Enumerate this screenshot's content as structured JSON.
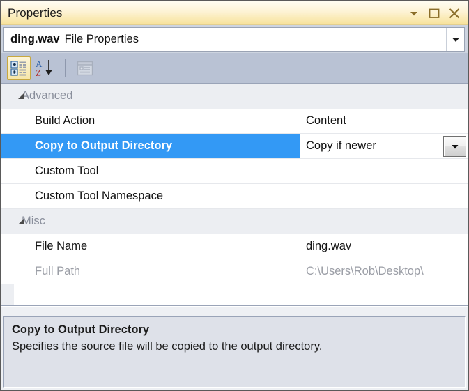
{
  "window": {
    "title": "Properties",
    "buttons": [
      {
        "name": "dropdown",
        "label": "Window options"
      },
      {
        "name": "maximize",
        "label": "Maximize"
      },
      {
        "name": "close",
        "label": "Close"
      }
    ]
  },
  "selector": {
    "object_name": "ding.wav",
    "object_type": "File Properties",
    "arrow": "chevron-down-icon"
  },
  "toolbar": {
    "categorized": {
      "label": "Categorized",
      "active": true
    },
    "alphabetical": {
      "label": "Alphabetical",
      "active": false,
      "letter_top": "A",
      "letter_bottom": "Z"
    },
    "property_pages": {
      "label": "Property Pages",
      "disabled": true
    }
  },
  "grid": {
    "categories": [
      {
        "name": "Advanced",
        "expanded": true,
        "properties": [
          {
            "name": "Build Action",
            "value": "Content",
            "selected": false,
            "readonly": false,
            "editor": "none"
          },
          {
            "name": "Copy to Output Directory",
            "value": "Copy if newer",
            "selected": true,
            "readonly": false,
            "editor": "dropdown"
          },
          {
            "name": "Custom Tool",
            "value": "",
            "selected": false,
            "readonly": false,
            "editor": "none"
          },
          {
            "name": "Custom Tool Namespace",
            "value": "",
            "selected": false,
            "readonly": false,
            "editor": "none"
          }
        ]
      },
      {
        "name": "Misc",
        "expanded": true,
        "properties": [
          {
            "name": "File Name",
            "value": "ding.wav",
            "selected": false,
            "readonly": false,
            "editor": "none"
          },
          {
            "name": "Full Path",
            "value": "C:\\Users\\Rob\\Desktop\\",
            "selected": false,
            "readonly": true,
            "editor": "none"
          }
        ]
      }
    ]
  },
  "description": {
    "title": "Copy to Output Directory",
    "text": "Specifies the source file will be copied to the output directory."
  },
  "colors": {
    "title_gradient_top": "#fffdf2",
    "title_gradient_bottom": "#f7e29a",
    "selection_blue": "#3399f5",
    "toolbar_bg": "#b9c2d4",
    "category_bg": "#eceef2",
    "description_bg": "#dee1e9",
    "frame_border": "#5a5a5a"
  }
}
